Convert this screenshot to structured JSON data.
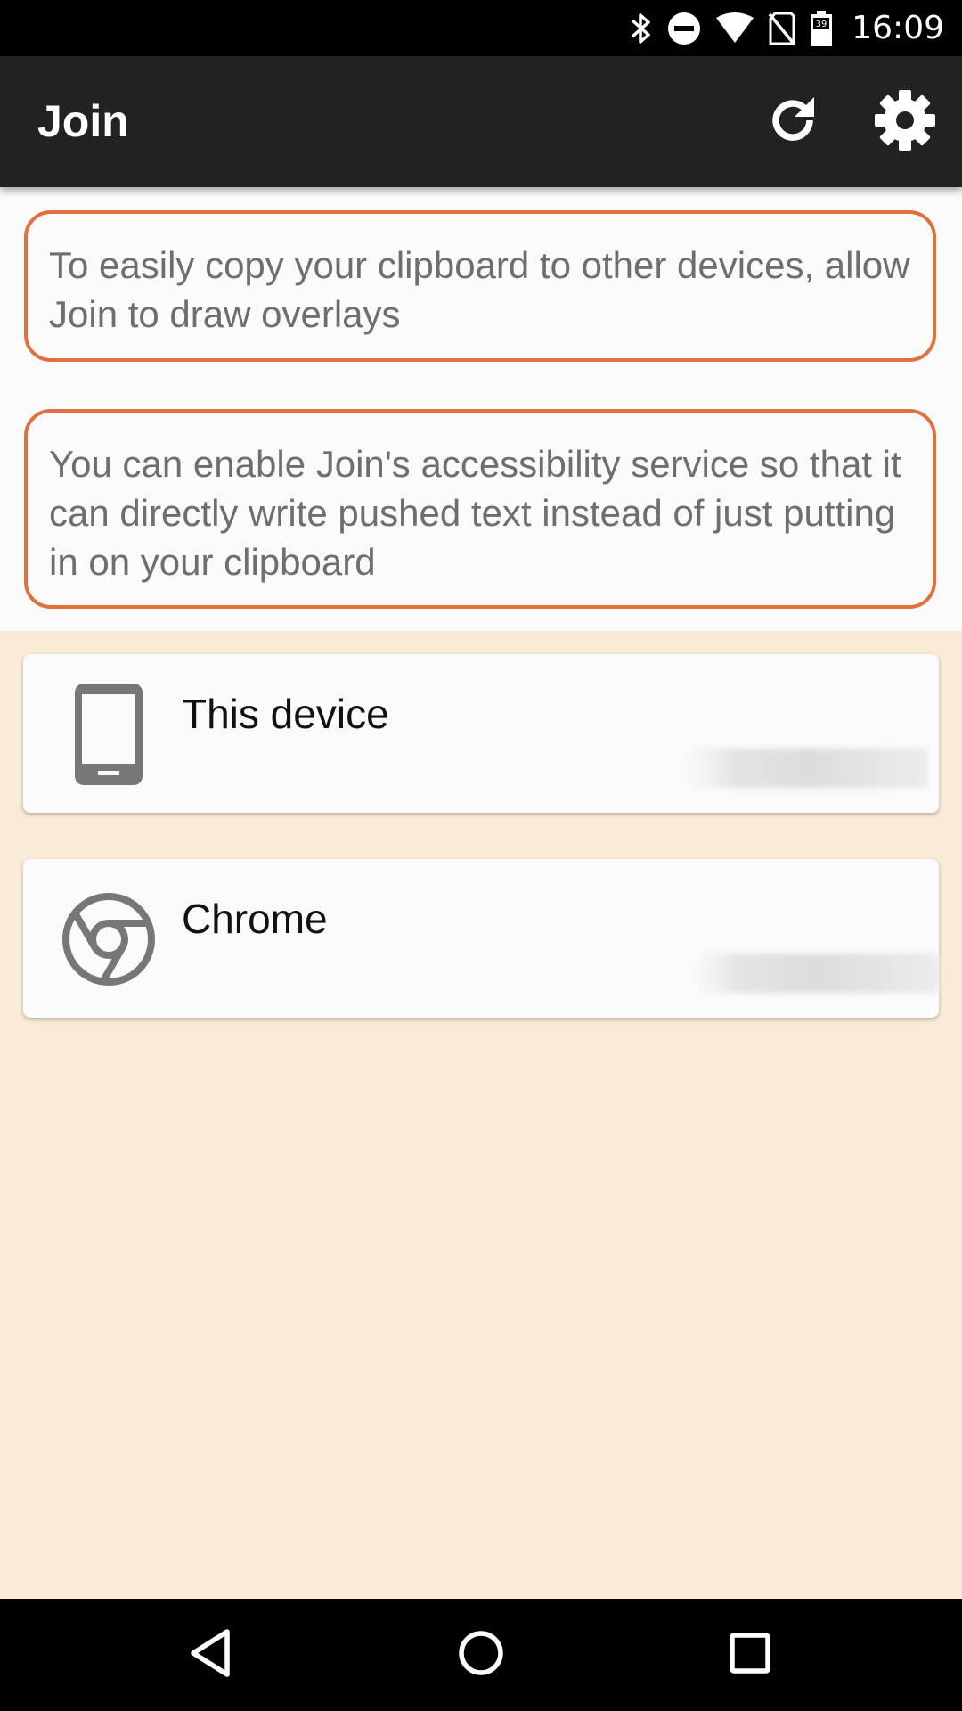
{
  "status_bar": {
    "time": "16:09",
    "battery_level": "39",
    "icons": [
      "bluetooth-icon",
      "do-not-disturb-icon",
      "wifi-icon",
      "no-sim-icon",
      "battery-icon"
    ]
  },
  "app_bar": {
    "title": "Join",
    "actions": [
      "refresh-icon",
      "settings-gear-icon"
    ]
  },
  "notices": [
    {
      "text": "To easily copy your clipboard to other devices, allow Join to draw overlays"
    },
    {
      "text": "You can enable Join's accessibility service so that it can directly write pushed text instead of just putting in on your clipboard"
    }
  ],
  "devices": [
    {
      "name": "This device",
      "icon": "smartphone-icon"
    },
    {
      "name": "Chrome",
      "icon": "chrome-icon"
    }
  ],
  "nav_bar": {
    "buttons": [
      "back-icon",
      "home-icon",
      "recents-icon"
    ]
  },
  "colors": {
    "status_bar": "#000000",
    "app_bar": "#222222",
    "notice_border": "#e07040",
    "notice_text": "#6e6e6e",
    "list_background": "#faebd7",
    "card_background": "#fafafa",
    "icon_gray": "#777777"
  }
}
